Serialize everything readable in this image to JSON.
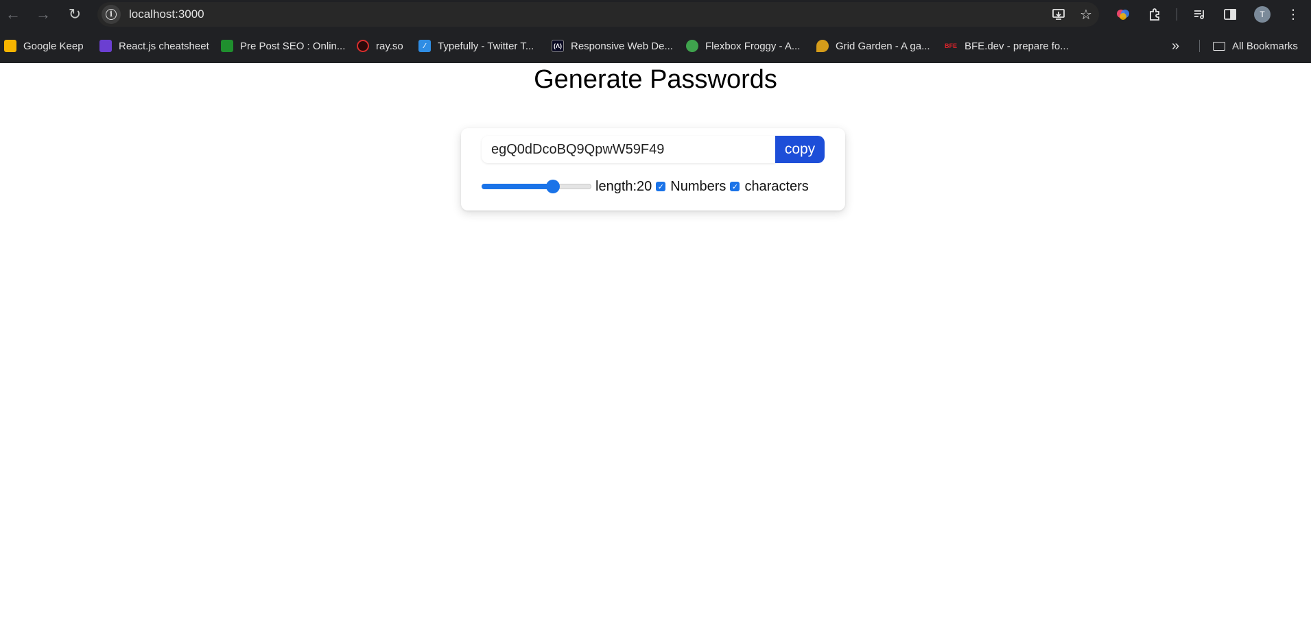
{
  "browser": {
    "url": "localhost:3000",
    "avatar_initial": "T",
    "bookmarks": [
      {
        "label": "Google Keep",
        "favicon_color": "#f6b400",
        "favicon_glyph": ""
      },
      {
        "label": "React.js cheatsheet",
        "favicon_color": "#6b3fd1",
        "favicon_glyph": ""
      },
      {
        "label": "Pre Post SEO : Onlin...",
        "favicon_color": "#1f8f2e",
        "favicon_glyph": ""
      },
      {
        "label": "ray.so",
        "favicon_color": "#d62d2d",
        "favicon_glyph": ""
      },
      {
        "label": "Typefully - Twitter T...",
        "favicon_color": "#2f8de4",
        "favicon_glyph": ""
      },
      {
        "label": "Responsive Web De...",
        "favicon_color": "#0a0a23",
        "favicon_glyph": ""
      },
      {
        "label": "Flexbox Froggy - A...",
        "favicon_color": "#3fa34d",
        "favicon_glyph": ""
      },
      {
        "label": "Grid Garden - A ga...",
        "favicon_color": "#d59c1a",
        "favicon_glyph": ""
      },
      {
        "label": "BFE.dev - prepare fo...",
        "favicon_color": "#d8232a",
        "favicon_glyph": "BFE"
      }
    ],
    "all_bookmarks_label": "All Bookmarks"
  },
  "page": {
    "title": "Generate Passwords",
    "password_value": "egQ0dDcoBQ9QpwW59F49",
    "copy_label": "copy",
    "length_label": "length:20",
    "length_value": 20,
    "length_slider_fraction": 0.65,
    "numbers_label": "Numbers",
    "numbers_checked": true,
    "characters_label": "characters",
    "characters_checked": true
  },
  "colors": {
    "accent": "#1d4ed8",
    "slider_accent": "#1a73e8",
    "chrome_bg": "#202124"
  }
}
